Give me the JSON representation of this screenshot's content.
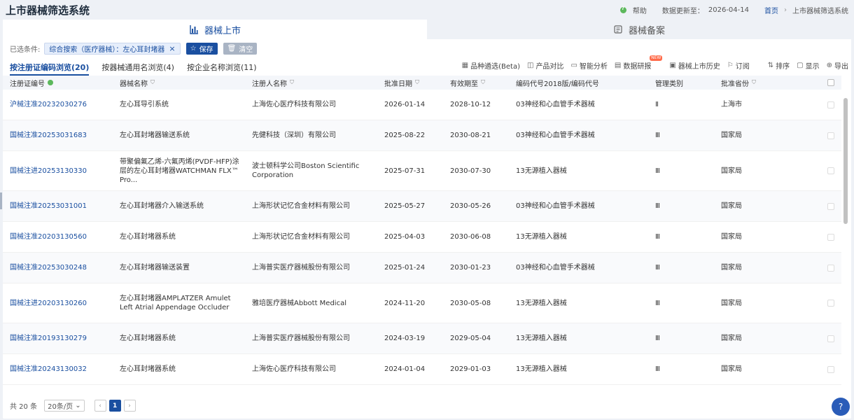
{
  "app": {
    "title": "上市器械筛选系统",
    "help": "帮助",
    "data_updated_label": "数据更新至：",
    "data_updated_date": "2026-04-14",
    "breadcrumb_home": "首页",
    "breadcrumb_current": "上市器械筛选系统"
  },
  "main_tabs": [
    {
      "label": "器械上市",
      "icon": "chart-bar-icon"
    },
    {
      "label": "器械备案",
      "icon": "document-icon"
    }
  ],
  "filters": {
    "label": "已选条件:",
    "chip": "综合搜索（医疗器械）：左心耳封堵器",
    "save": "保存",
    "clear": "清空"
  },
  "sub_tabs": [
    "按注册证编码浏览(20)",
    "按器械通用名浏览(4)",
    "按企业名称浏览(11)"
  ],
  "toolbar": {
    "variety": "品种遴选(Beta)",
    "compare": "产品对比",
    "analysis": "智能分析",
    "research": "数据研报",
    "new_badge": "NEW",
    "history": "器械上市历史",
    "subscribe": "订阅",
    "sort": "排序",
    "display": "显示",
    "export": "导出"
  },
  "table": {
    "headers": [
      "注册证编号",
      "器械名称",
      "注册人名称",
      "批准日期",
      "有效期至",
      "编码代号2018版/编码代号",
      "管理类别",
      "批准省份"
    ],
    "rows": [
      {
        "reg": "沪械注准20232030276",
        "name": "左心耳导引系统",
        "company": "上海佐心医疗科技有限公司",
        "approve": "2026-01-14",
        "expire": "2028-10-12",
        "code": "03神经和心血管手术器械",
        "class": "Ⅱ",
        "province": "上海市"
      },
      {
        "reg": "国械注准20253031683",
        "name": "左心耳封堵器输送系统",
        "company": "先健科技（深圳）有限公司",
        "approve": "2025-08-22",
        "expire": "2030-08-21",
        "code": "03神经和心血管手术器械",
        "class": "Ⅲ",
        "province": "国家局"
      },
      {
        "reg": "国械注进20253130330",
        "name": "带聚偏氟乙烯-六氟丙烯(PVDF-HFP)涂层的左心耳封堵器WATCHMAN FLX™ Pro...",
        "company": "波士顿科学公司Boston Scientific Corporation",
        "approve": "2025-07-31",
        "expire": "2030-07-30",
        "code": "13无源植入器械",
        "class": "Ⅲ",
        "province": "国家局"
      },
      {
        "reg": "国械注准20253031001",
        "name": "左心耳封堵器介入输送系统",
        "company": "上海形状记忆合金材料有限公司",
        "approve": "2025-05-27",
        "expire": "2030-05-26",
        "code": "03神经和心血管手术器械",
        "class": "Ⅲ",
        "province": "国家局"
      },
      {
        "reg": "国械注准20203130560",
        "name": "左心耳封堵器系统",
        "company": "上海形状记忆合金材料有限公司",
        "approve": "2025-04-03",
        "expire": "2030-06-08",
        "code": "13无源植入器械",
        "class": "Ⅲ",
        "province": "国家局"
      },
      {
        "reg": "国械注准20253030248",
        "name": "左心耳封堵器输送装置",
        "company": "上海普实医疗器械股份有限公司",
        "approve": "2025-01-24",
        "expire": "2030-01-23",
        "code": "03神经和心血管手术器械",
        "class": "Ⅲ",
        "province": "国家局"
      },
      {
        "reg": "国械注进20203130260",
        "name": "左心耳封堵器AMPLATZER Amulet Left Atrial Appendage Occluder",
        "company": "雅培医疗器械Abbott Medical",
        "approve": "2024-11-20",
        "expire": "2030-05-08",
        "code": "13无源植入器械",
        "class": "Ⅲ",
        "province": "国家局"
      },
      {
        "reg": "国械注准20193130279",
        "name": "左心耳封堵器系统",
        "company": "上海普实医疗器械股份有限公司",
        "approve": "2024-03-19",
        "expire": "2029-05-04",
        "code": "13无源植入器械",
        "class": "Ⅲ",
        "province": "国家局"
      },
      {
        "reg": "国械注准20243130032",
        "name": "左心耳封堵器系统",
        "company": "上海佐心医疗科技有限公司",
        "approve": "2024-01-04",
        "expire": "2029-01-03",
        "code": "13无源植入器械",
        "class": "Ⅲ",
        "province": "国家局"
      }
    ]
  },
  "footer": {
    "total": "共 20 条",
    "page_size": "20条/页",
    "current_page": "1"
  },
  "colors": {
    "primary": "#1a4fa0",
    "background": "#eef1f6"
  }
}
